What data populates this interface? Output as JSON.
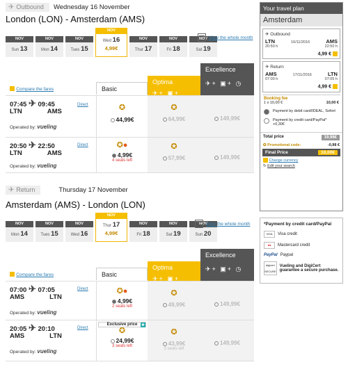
{
  "outbound": {
    "tab": "Outbound",
    "date": "Wednesday 16 November",
    "route": "London (LON) - Amsterdam (AMS)",
    "days": [
      {
        "mon": "NOV",
        "dow": "Sun",
        "d": "13"
      },
      {
        "mon": "NOV",
        "dow": "Mon",
        "d": "14"
      },
      {
        "mon": "NOV",
        "dow": "Tues",
        "d": "15"
      },
      {
        "mon": "NOV",
        "dow": "Wed",
        "d": "16",
        "price": "4,99€"
      },
      {
        "mon": "NOV",
        "dow": "Thur",
        "d": "17"
      },
      {
        "mon": "NOV",
        "dow": "Fri",
        "d": "18"
      },
      {
        "mon": "NOV",
        "dow": "Sat",
        "d": "19"
      }
    ],
    "view_month": "View the whole month",
    "compare": "Compare the fares",
    "basic": "Basic",
    "optima": "Optima",
    "excellence": "Excellence",
    "flights": [
      {
        "dep": "07:45",
        "from": "LTN",
        "arr": "09:45",
        "to": "AMS",
        "direct": "Direct",
        "opby": "Operated by:",
        "carrier": "vueling",
        "basic": "44,99€",
        "optima": "64,99€",
        "excellence": "149,99€",
        "seats": ""
      },
      {
        "dep": "20:50",
        "from": "LTN",
        "arr": "22:50",
        "to": "AMS",
        "direct": "Direct",
        "opby": "Operated by:",
        "carrier": "vueling",
        "basic": "4,99€",
        "optima": "57,99€",
        "excellence": "149,99€",
        "seats": "4 seats left"
      }
    ]
  },
  "return": {
    "tab": "Return",
    "date": "Thursday 17 November",
    "route": "Amsterdam (AMS) - London (LON)",
    "days": [
      {
        "mon": "NOV",
        "dow": "Mon",
        "d": "14"
      },
      {
        "mon": "NOV",
        "dow": "Tues",
        "d": "15"
      },
      {
        "mon": "NOV",
        "dow": "Wed",
        "d": "16"
      },
      {
        "mon": "NOV",
        "dow": "Thur",
        "d": "17",
        "price": "4,99€"
      },
      {
        "mon": "NOV",
        "dow": "Fri",
        "d": "18"
      },
      {
        "mon": "NOV",
        "dow": "Sat",
        "d": "19"
      },
      {
        "mon": "NOV",
        "dow": "Sun",
        "d": "20"
      }
    ],
    "view_month": "View the whole month",
    "compare": "Compare the fares",
    "basic": "Basic",
    "optima": "Optima",
    "excellence": "Excellence",
    "flights": [
      {
        "dep": "07:00",
        "from": "AMS",
        "arr": "07:05",
        "to": "LTN",
        "direct": "Direct",
        "opby": "Operated by:",
        "carrier": "vueling",
        "basic": "4,99€",
        "optima": "49,99€",
        "excellence": "149,99€",
        "seats": "2 seats left"
      },
      {
        "dep": "20:05",
        "from": "AMS",
        "arr": "20:10",
        "to": "LTN",
        "direct": "Direct",
        "opby": "Operated by:",
        "carrier": "vueling",
        "basic": "24,99€",
        "optima": "43,99€",
        "excellence": "149,99€",
        "seats": "3 seats left",
        "badge": "Exclusive price"
      }
    ]
  },
  "plan": {
    "title": "Your travel plan",
    "city": "Amsterdam",
    "out": {
      "label": "Outbound",
      "from": "LTN",
      "time1": "20:50 h",
      "date": "16/11/2016",
      "to": "AMS",
      "time2": "22:50 h",
      "price": "4,99 €"
    },
    "ret": {
      "label": "Return",
      "from": "AMS",
      "time1": "07:00 h",
      "date": "17/11/2016",
      "to": "LTN",
      "time2": "07:05 h",
      "price": "4,99 €"
    },
    "booking_fee": "Booking fee",
    "fee_line": "1 x 10,00 €",
    "fee_amount": "10,00 €",
    "pay1": "Payment by debit card/IDEAL, Sofort",
    "pay2": "Payment by credit card/PayPal* +0,30€",
    "total_label": "Total price",
    "total": "19,98€",
    "promo_label": "Promotional code:",
    "promo": "-0,98 €",
    "final_label": "Final Price",
    "final": "10,00€",
    "change": "Change currency",
    "edit": "Edit your search"
  },
  "payinfo": {
    "title": "*Payment by credit card/PayPal",
    "visa": "Visa credit",
    "mc": "Mastercard credit",
    "paypal": "Paypal",
    "digi": "Vueling and DigiCert guarantee a secure purchase."
  }
}
